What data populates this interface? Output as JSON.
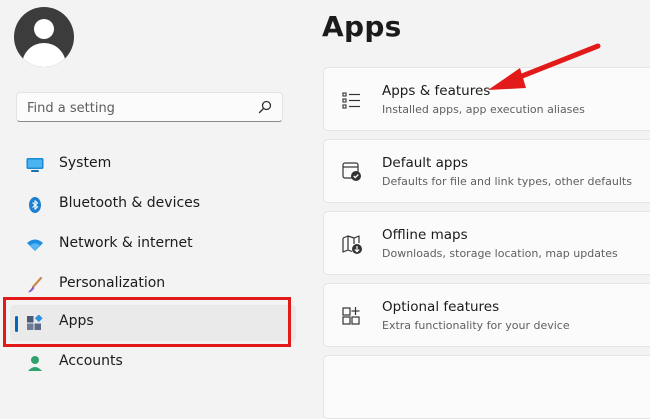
{
  "sidebar": {
    "avatar_icon": "user-avatar-icon",
    "search": {
      "placeholder": "Find a setting",
      "icon": "search-icon"
    },
    "items": [
      {
        "label": "System",
        "icon": "monitor-icon"
      },
      {
        "label": "Bluetooth & devices",
        "icon": "bluetooth-icon"
      },
      {
        "label": "Network & internet",
        "icon": "wifi-icon"
      },
      {
        "label": "Personalization",
        "icon": "brush-icon"
      },
      {
        "label": "Apps",
        "icon": "apps-icon",
        "selected": true
      },
      {
        "label": "Accounts",
        "icon": "person-icon"
      }
    ]
  },
  "main": {
    "title": "Apps",
    "cards": [
      {
        "title": "Apps & features",
        "subtitle": "Installed apps, app execution aliases",
        "icon": "list-icon"
      },
      {
        "title": "Default apps",
        "subtitle": "Defaults for file and link types, other defaults",
        "icon": "default-apps-icon"
      },
      {
        "title": "Offline maps",
        "subtitle": "Downloads, storage location, map updates",
        "icon": "map-icon"
      },
      {
        "title": "Optional features",
        "subtitle": "Extra functionality for your device",
        "icon": "optional-features-icon"
      }
    ]
  },
  "annotations": {
    "arrow_color": "#e21a1a",
    "box_color": "#e21a1a"
  },
  "colors": {
    "accent": "#0067c0",
    "background": "#f3f3f3",
    "card": "#fbfbfb"
  }
}
